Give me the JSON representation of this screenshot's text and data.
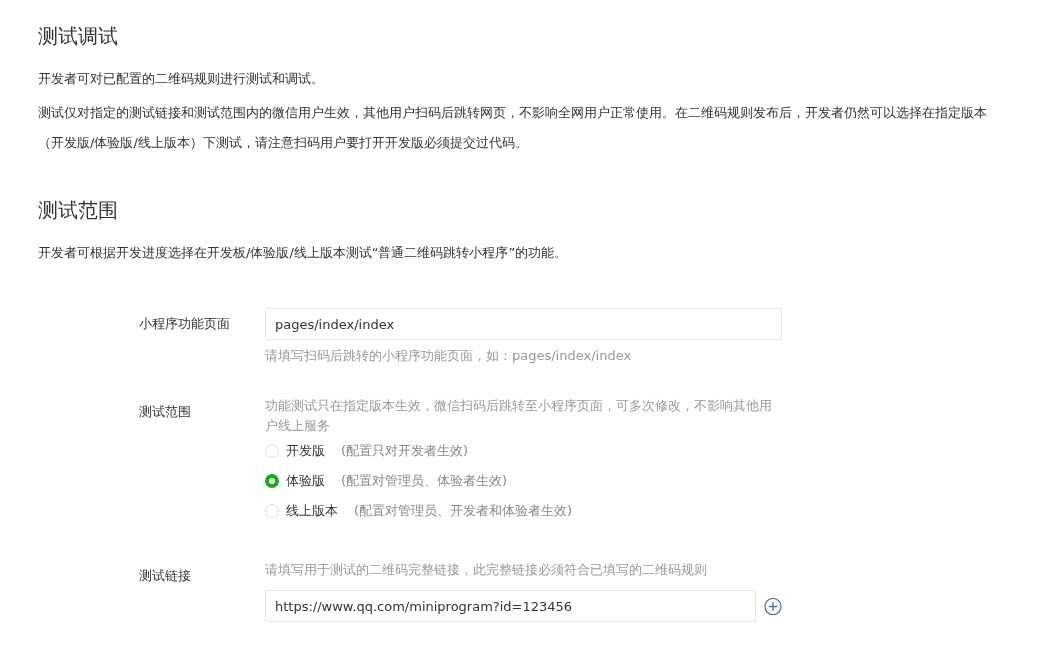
{
  "sections": [
    {
      "title": "测试调试",
      "paragraphs": [
        "开发者可对已配置的二维码规则进行测试和调试。",
        "测试仅对指定的测试链接和测试范围内的微信用户生效，其他用户扫码后跳转网页，不影响全网用户正常使用。在二维码规则发布后，开发者仍然可以选择在指定版本（开发版/体验版/线上版本）下测试，请注意扫码用户要打开开发版必须提交过代码。"
      ]
    },
    {
      "title": "测试范围",
      "paragraphs": [
        "开发者可根据开发进度选择在开发板/体验版/线上版本测试“普通二维码跳转小程序”的功能。"
      ]
    }
  ],
  "form": [
    {
      "kind": "input",
      "label": "小程序功能页面",
      "value": "pages/index/index",
      "hint": "请填写扫码后跳转的小程序功能页面，如：pages/index/index"
    },
    {
      "kind": "radio",
      "label": "测试范围",
      "hint": "功能测试只在指定版本生效，微信扫码后跳转至小程序页面，可多次修改，不影响其他用户线上服务",
      "options": [
        {
          "label": "开发版",
          "note": "(配置只对开发者生效)",
          "selected": false
        },
        {
          "label": "体验版",
          "note": "(配置对管理员、体验者生效)",
          "selected": true
        },
        {
          "label": "线上版本",
          "note": "(配置对管理员、开发者和体验者生效)",
          "selected": false
        }
      ]
    },
    {
      "kind": "link",
      "label": "测试链接",
      "hint": "请填写用于测试的二维码完整链接，此完整链接必须符合已填写的二维码规则",
      "value": "https://www.qq.com/miniprogram?id=123456"
    }
  ]
}
